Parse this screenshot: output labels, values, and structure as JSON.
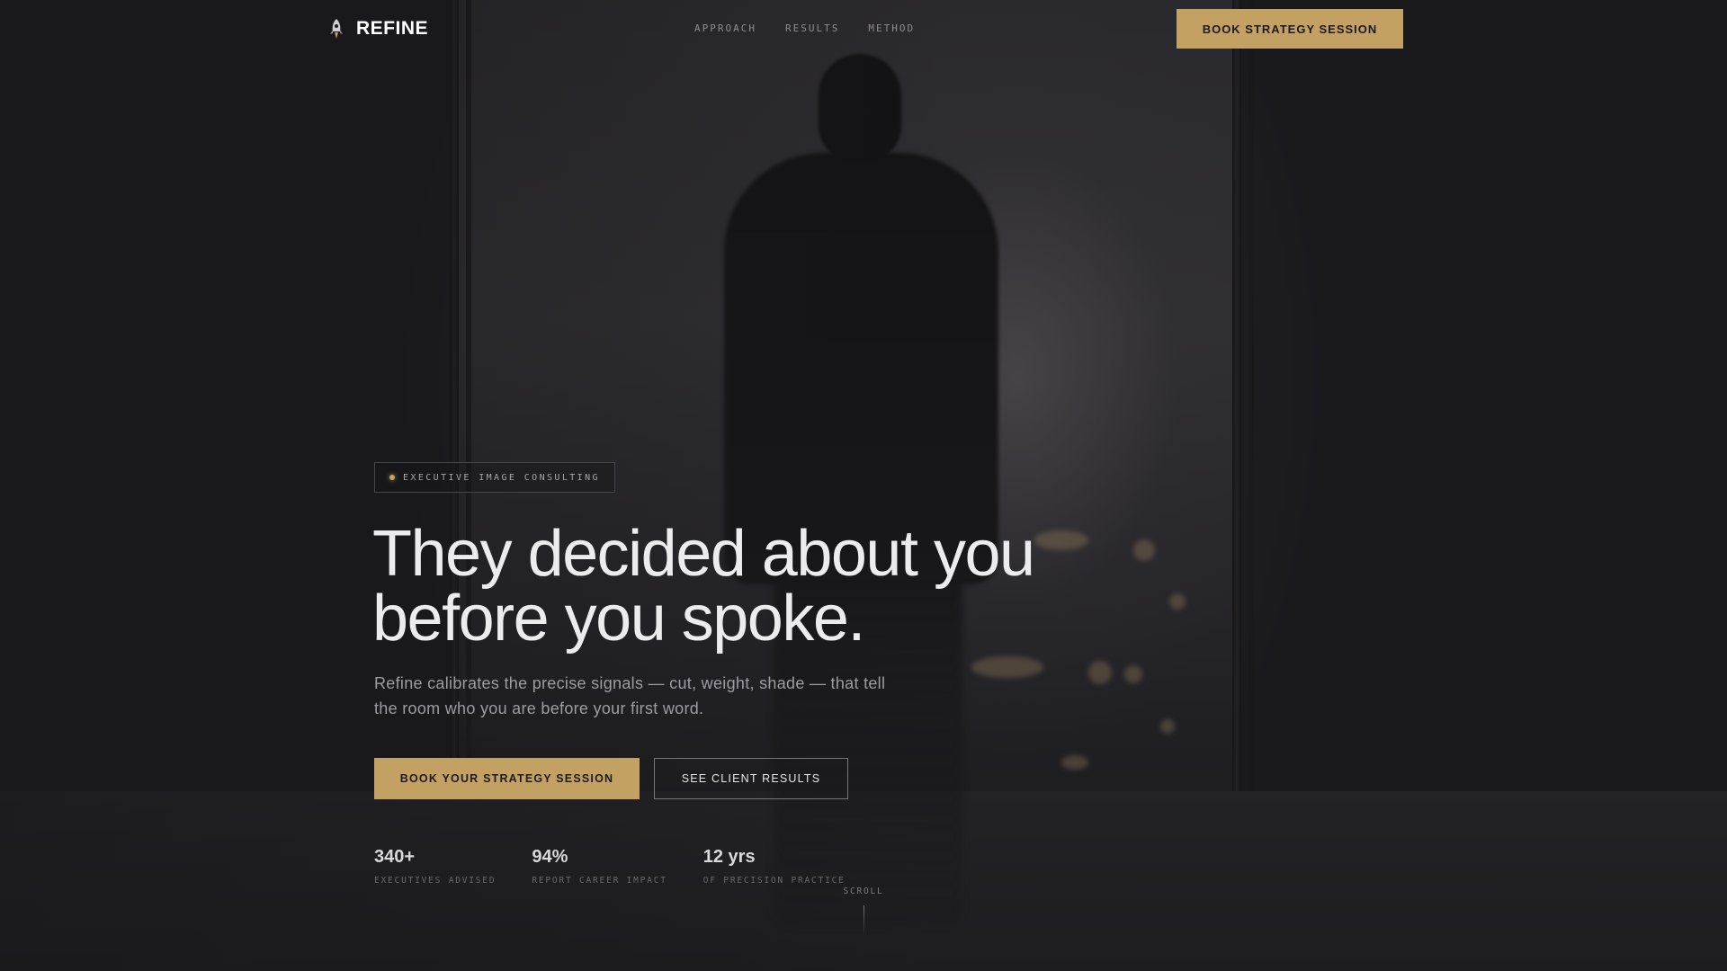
{
  "brand": {
    "name": "REFINE",
    "logo_icon": "rocket-icon"
  },
  "nav": {
    "items": [
      {
        "label": "APPROACH"
      },
      {
        "label": "RESULTS"
      },
      {
        "label": "METHOD"
      }
    ]
  },
  "header": {
    "cta_label": "BOOK STRATEGY SESSION"
  },
  "hero": {
    "eyebrow": "EXECUTIVE IMAGE CONSULTING",
    "headline_line1": "They decided about you",
    "headline_line2": "before you spoke.",
    "subcopy": "Refine calibrates the precise signals — cut, weight, shade — that tell the room who you are before your first word.",
    "primary_cta": "BOOK YOUR STRATEGY SESSION",
    "secondary_cta": "SEE CLIENT RESULTS"
  },
  "stats": [
    {
      "value": "340+",
      "label": "EXECUTIVES ADVISED"
    },
    {
      "value": "94%",
      "label": "REPORT CAREER IMPACT"
    },
    {
      "value": "12 yrs",
      "label": "OF PRECISION PRACTICE"
    }
  ],
  "scroll": {
    "label": "SCROLL"
  },
  "colors": {
    "accent_gold": "#c3a163",
    "background": "#1c1c1f",
    "text_primary": "#ececef",
    "text_muted": "#9d9ca2"
  }
}
